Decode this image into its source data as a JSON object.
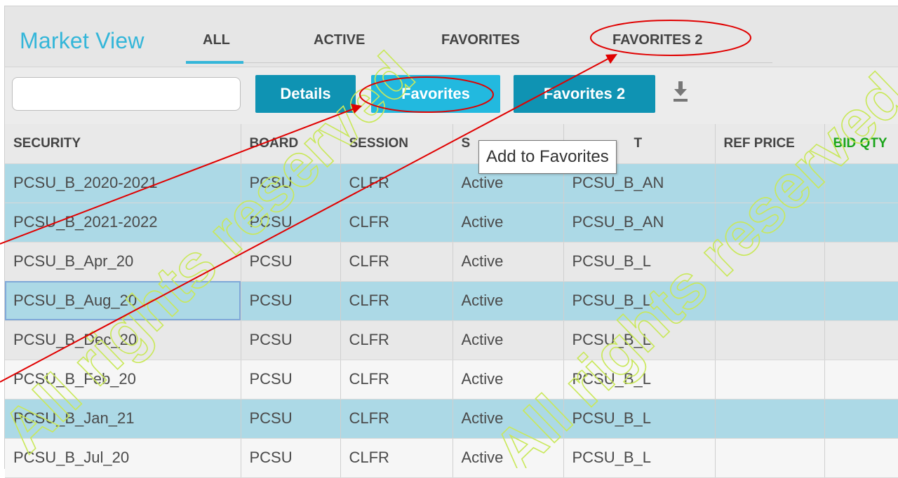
{
  "header": {
    "title": "Market View",
    "tabs": [
      {
        "label": "ALL"
      },
      {
        "label": "ACTIVE"
      },
      {
        "label": "FAVORITES"
      },
      {
        "label": "FAVORITES 2"
      }
    ],
    "active_tab": "ALL"
  },
  "toolbar": {
    "search_value": "",
    "buttons": [
      {
        "label": "Details"
      },
      {
        "label": "Favorites"
      },
      {
        "label": "Favorites 2"
      }
    ],
    "download_icon": "download-icon"
  },
  "tooltip": "Add to Favorites",
  "table": {
    "columns": [
      "SECURITY",
      "BOARD",
      "SESSION",
      "S",
      "PRODUCT",
      "REF PRICE",
      "BID QTY"
    ],
    "visible_columns": [
      "SECURITY",
      "BOARD",
      "SESSION",
      "S",
      "T",
      "REF PRICE",
      "BID QTY"
    ],
    "rows": [
      {
        "security": "PCSU_B_2020-2021",
        "board": "PCSU",
        "session": "CLFR",
        "status": "Active",
        "product": "PCSU_B_AN"
      },
      {
        "security": "PCSU_B_2021-2022",
        "board": "PCSU",
        "session": "CLFR",
        "status": "Active",
        "product": "PCSU_B_AN"
      },
      {
        "security": "PCSU_B_Apr_20",
        "board": "PCSU",
        "session": "CLFR",
        "status": "Active",
        "product": "PCSU_B_L"
      },
      {
        "security": "PCSU_B_Aug_20",
        "board": "PCSU",
        "session": "CLFR",
        "status": "Active",
        "product": "PCSU_B_L"
      },
      {
        "security": "PCSU_B_Dec_20",
        "board": "PCSU",
        "session": "CLFR",
        "status": "Active",
        "product": "PCSU_B_L"
      },
      {
        "security": "PCSU_B_Feb_20",
        "board": "PCSU",
        "session": "CLFR",
        "status": "Active",
        "product": "PCSU_B_L"
      },
      {
        "security": "PCSU_B_Jan_21",
        "board": "PCSU",
        "session": "CLFR",
        "status": "Active",
        "product": "PCSU_B_L"
      },
      {
        "security": "PCSU_B_Jul_20",
        "board": "PCSU",
        "session": "CLFR",
        "status": "Active",
        "product": "PCSU_B_L"
      }
    ]
  },
  "colors": {
    "accent": "#34b6d9",
    "button_dark": "#0f93b3",
    "button_light": "#22b9df",
    "row_highlight": "#acd9e6",
    "bid_qty_header": "#1aa51a",
    "annotation": "#e00000"
  },
  "watermark": "All rights reserved"
}
